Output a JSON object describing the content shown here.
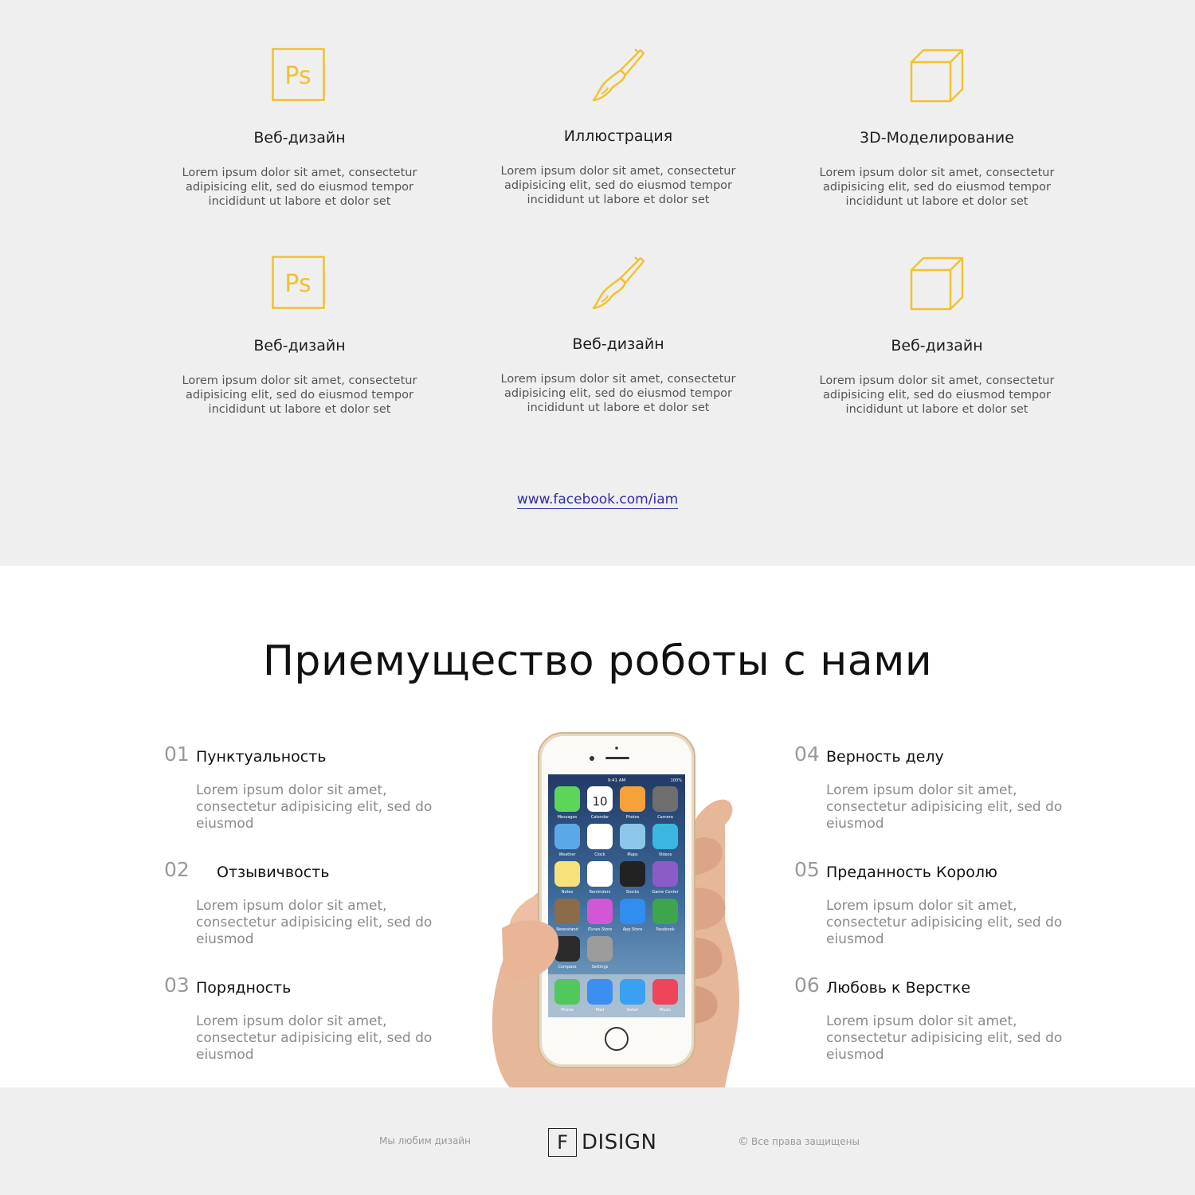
{
  "services": {
    "items": [
      {
        "icon": "photoshop-icon",
        "title": "Веб-дизайн",
        "text": "Lorem ipsum dolor sit amet, consectetur adipisicing elit, sed do eiusmod tempor incididunt ut labore et dolor set"
      },
      {
        "icon": "brush-icon",
        "title": "Иллюстрация",
        "text": "Lorem ipsum dolor sit amet, consectetur adipisicing elit, sed do eiusmod tempor incididunt ut labore et dolor set"
      },
      {
        "icon": "cube-icon",
        "title": "3D-Моделирование",
        "text": "Lorem ipsum dolor sit amet, consectetur adipisicing elit, sed do eiusmod tempor incididunt ut labore et dolor set"
      },
      {
        "icon": "photoshop-icon",
        "title": "Веб-дизайн",
        "text": "Lorem ipsum dolor sit amet, consectetur adipisicing elit, sed do eiusmod tempor incididunt ut labore et dolor set"
      },
      {
        "icon": "brush-icon",
        "title": "Веб-дизайн",
        "text": "Lorem ipsum dolor sit amet, consectetur adipisicing elit, sed do eiusmod tempor incididunt ut labore et dolor set"
      },
      {
        "icon": "cube-icon",
        "title": "Веб-дизайн",
        "text": "Lorem ipsum dolor sit amet, consectetur adipisicing elit, sed do eiusmod tempor incididunt ut labore et dolor set"
      }
    ],
    "link_text": "www.facebook.com/iam",
    "icon_text": "Ps",
    "accent_color": "#f2c12e"
  },
  "advantages": {
    "title": "Приемущество роботы с нами",
    "items": [
      {
        "num": "01",
        "title": "Пунктуальность",
        "text": "Lorem ipsum dolor sit amet, consectetur adipisicing elit, sed do eiusmod"
      },
      {
        "num": "02",
        "title": "Отзывичвость",
        "text": "Lorem ipsum dolor sit amet, consectetur adipisicing elit, sed do eiusmod"
      },
      {
        "num": "03",
        "title": "Порядность",
        "text": "Lorem ipsum dolor sit amet, consectetur adipisicing elit, sed do eiusmod"
      },
      {
        "num": "04",
        "title": "Верность делу",
        "text": "Lorem ipsum dolor sit amet, consectetur adipisicing elit, sed do eiusmod"
      },
      {
        "num": "05",
        "title": "Преданность Королю",
        "text": "Lorem ipsum dolor sit amet, consectetur adipisicing elit, sed do eiusmod"
      },
      {
        "num": "06",
        "title": "Любовь к Верстке",
        "text": "Lorem ipsum dolor sit amet, consectetur adipisicing elit, sed do eiusmod"
      }
    ],
    "phone": {
      "status_time": "9:41 AM",
      "battery": "100%",
      "calendar_day": "10",
      "app_labels": [
        "Messages",
        "Calendar",
        "Photos",
        "Camera",
        "Weather",
        "Clock",
        "Maps",
        "Videos",
        "Notes",
        "Reminders",
        "Stocks",
        "Game Center",
        "Newsstand",
        "iTunes Store",
        "App Store",
        "Passbook",
        "Compass",
        "Settings"
      ],
      "dock_labels": [
        "Phone",
        "Mail",
        "Safari",
        "Music"
      ]
    }
  },
  "footer": {
    "left_text": "Мы любим дизайн",
    "logo_letter": "F",
    "logo_word": "DISIGN",
    "copyright_symbol": "©",
    "right_text": "Все права защищены"
  }
}
